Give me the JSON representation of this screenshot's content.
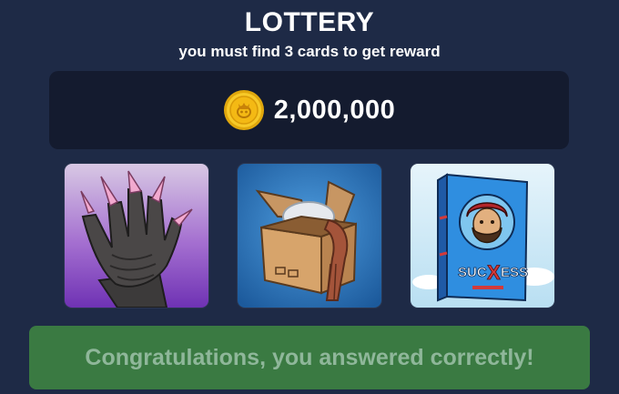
{
  "header": {
    "title": "LOTTERY",
    "subtitle": "you must find 3 cards to get reward"
  },
  "reward": {
    "icon": "gold-coin-icon",
    "amount": "2,000,000"
  },
  "cards": [
    {
      "icon": "gloved-hand-with-pink-nails-icon"
    },
    {
      "icon": "open-cardboard-box-icon"
    },
    {
      "icon": "success-book-icon",
      "label": "SUCXESS"
    }
  ],
  "result": {
    "message": "Congratulations, you answered correctly!"
  },
  "colors": {
    "background": "#1e2a46",
    "panel": "#141b2f",
    "coin": "#f4c21a",
    "banner": "#3a7a42",
    "banner_text": "#8fb79a"
  }
}
